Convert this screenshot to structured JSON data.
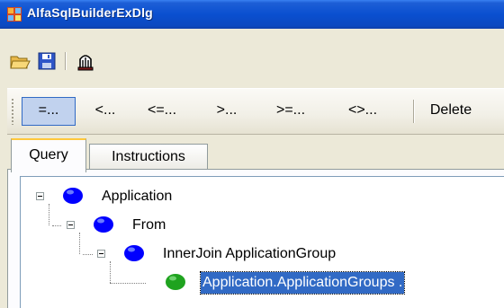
{
  "window": {
    "title": "AlfaSqlBuilderExDlg"
  },
  "toolbar_main": {
    "buttons": [
      {
        "name": "open",
        "icon": "folder-open-icon"
      },
      {
        "name": "save",
        "icon": "floppy-disk-icon"
      },
      {
        "name": "execute",
        "icon": "gear-bell-icon"
      }
    ]
  },
  "toolbar_ops": {
    "eq": "=...",
    "lt": "<...",
    "le": "<=...",
    "gt": ">...",
    "ge": ">=...",
    "ne": "<>...",
    "delete": "Delete"
  },
  "tabs": [
    {
      "label": "Query",
      "selected": true
    },
    {
      "label": "Instructions",
      "selected": false
    }
  ],
  "tree": {
    "nodes": [
      {
        "label": "Application",
        "color": "#0000ff",
        "level": 0
      },
      {
        "label": "From",
        "color": "#0000ff",
        "level": 1
      },
      {
        "label": "InnerJoin  ApplicationGroup",
        "color": "#0000ff",
        "level": 2
      },
      {
        "label": "Application.ApplicationGroups  .",
        "color": "#1fa31f",
        "level": 3,
        "selected": true
      }
    ]
  },
  "colors": {
    "titlebar": "#0a4fd0",
    "selection": "#316ac5",
    "node_blue": "#0000ff",
    "node_green": "#1fa31f"
  }
}
